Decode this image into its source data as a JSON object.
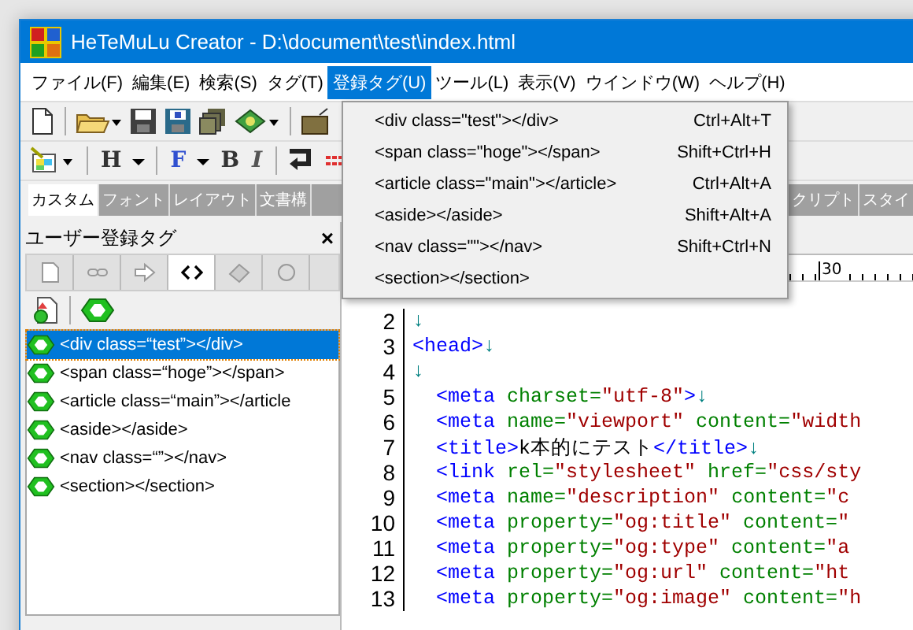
{
  "window": {
    "title": "HeTeMuLu Creator - D:\\document\\test\\index.html"
  },
  "menu": [
    {
      "label": "ファイル(F)",
      "selected": false
    },
    {
      "label": "編集(E)",
      "selected": false
    },
    {
      "label": "検索(S)",
      "selected": false
    },
    {
      "label": "タグ(T)",
      "selected": false
    },
    {
      "label": "登録タグ(U)",
      "selected": true
    },
    {
      "label": "ツール(L)",
      "selected": false
    },
    {
      "label": "表示(V)",
      "selected": false
    },
    {
      "label": "ウインドウ(W)",
      "selected": false
    },
    {
      "label": "ヘルプ(H)",
      "selected": false
    }
  ],
  "format_toolbar": {
    "buttons": [
      {
        "label": "H",
        "kind": "heading"
      },
      {
        "label": "F",
        "kind": "font"
      },
      {
        "label": "B",
        "kind": "bold"
      },
      {
        "label": "I",
        "kind": "italic"
      }
    ]
  },
  "category_tabs": [
    {
      "label": "カスタム",
      "selected": true
    },
    {
      "label": "フォント",
      "selected": false
    },
    {
      "label": "レイアウト",
      "selected": false
    },
    {
      "label": "文書構",
      "selected": false
    },
    {
      "label": "クリプト",
      "selected": false
    },
    {
      "label": "スタイ",
      "selected": false
    }
  ],
  "panel": {
    "title": "ユーザー登録タグ",
    "close": "×",
    "icon_tabs": [
      {
        "kind": "page",
        "selected": false
      },
      {
        "kind": "link",
        "selected": false
      },
      {
        "kind": "arrow",
        "selected": false
      },
      {
        "kind": "code",
        "selected": true
      },
      {
        "kind": "eraser",
        "selected": false
      },
      {
        "kind": "circle",
        "selected": false
      }
    ],
    "items": [
      {
        "label": "<div class=“test”></div>",
        "selected": true
      },
      {
        "label": "<span class=“hoge”></span>",
        "selected": false
      },
      {
        "label": "<article class=“main”></article",
        "selected": false
      },
      {
        "label": "<aside></aside>",
        "selected": false
      },
      {
        "label": "<nav class=“”></nav>",
        "selected": false
      },
      {
        "label": "<section></section>",
        "selected": false
      }
    ]
  },
  "dropdown": [
    {
      "label": "<div class=\"test\"></div>",
      "shortcut": "Ctrl+Alt+T"
    },
    {
      "label": "<span class=\"hoge\"></span>",
      "shortcut": "Shift+Ctrl+H"
    },
    {
      "label": "<article class=\"main\"></article>",
      "shortcut": "Ctrl+Alt+A"
    },
    {
      "label": "<aside></aside>",
      "shortcut": "Shift+Alt+A"
    },
    {
      "label": "<nav class=\"\"></nav>",
      "shortcut": "Shift+Ctrl+N"
    },
    {
      "label": "<section></section>"
    }
  ],
  "editor": {
    "ruler": "30",
    "lines": [
      {
        "number": "2",
        "segments": [
          {
            "kind": "newline",
            "text": "↓"
          }
        ]
      },
      {
        "number": "3",
        "segments": [
          {
            "kind": "tag",
            "text": "<head>"
          },
          {
            "kind": "newline",
            "text": "↓"
          }
        ]
      },
      {
        "number": "4",
        "segments": [
          {
            "kind": "newline",
            "text": "↓"
          }
        ]
      },
      {
        "number": "5",
        "segments": [
          {
            "kind": "tag",
            "text": "  <meta"
          },
          {
            "kind": "attr",
            "text": " charset="
          },
          {
            "kind": "value",
            "text": "\"utf-8\""
          },
          {
            "kind": "tag",
            "text": ">"
          },
          {
            "kind": "newline",
            "text": "↓"
          }
        ]
      },
      {
        "number": "6",
        "segments": [
          {
            "kind": "tag",
            "text": "  <meta"
          },
          {
            "kind": "attr",
            "text": " name="
          },
          {
            "kind": "value",
            "text": "\"viewport\""
          },
          {
            "kind": "attr",
            "text": " content="
          },
          {
            "kind": "value",
            "text": "\"width"
          }
        ]
      },
      {
        "number": "7",
        "segments": [
          {
            "kind": "tag",
            "text": "  <title>"
          },
          {
            "kind": "text",
            "text": "k本的にテスト"
          },
          {
            "kind": "tag",
            "text": "</title>"
          },
          {
            "kind": "newline",
            "text": "↓"
          }
        ]
      },
      {
        "number": "8",
        "segments": [
          {
            "kind": "tag",
            "text": "  <link"
          },
          {
            "kind": "attr",
            "text": " rel="
          },
          {
            "kind": "value",
            "text": "\"stylesheet\""
          },
          {
            "kind": "attr",
            "text": " href="
          },
          {
            "kind": "value",
            "text": "\"css/sty"
          }
        ]
      },
      {
        "number": "9",
        "segments": [
          {
            "kind": "tag",
            "text": "  <meta"
          },
          {
            "kind": "attr",
            "text": " name="
          },
          {
            "kind": "value",
            "text": "\"description\""
          },
          {
            "kind": "attr",
            "text": " content="
          },
          {
            "kind": "value",
            "text": "\"c"
          }
        ]
      },
      {
        "number": "10",
        "segments": [
          {
            "kind": "tag",
            "text": "  <meta"
          },
          {
            "kind": "attr",
            "text": " property="
          },
          {
            "kind": "value",
            "text": "\"og:title\""
          },
          {
            "kind": "attr",
            "text": " content="
          },
          {
            "kind": "value",
            "text": "\""
          }
        ]
      },
      {
        "number": "11",
        "segments": [
          {
            "kind": "tag",
            "text": "  <meta"
          },
          {
            "kind": "attr",
            "text": " property="
          },
          {
            "kind": "value",
            "text": "\"og:type\""
          },
          {
            "kind": "attr",
            "text": " content="
          },
          {
            "kind": "value",
            "text": "\"a"
          }
        ]
      },
      {
        "number": "12",
        "segments": [
          {
            "kind": "tag",
            "text": "  <meta"
          },
          {
            "kind": "attr",
            "text": " property="
          },
          {
            "kind": "value",
            "text": "\"og:url\""
          },
          {
            "kind": "attr",
            "text": " content="
          },
          {
            "kind": "value",
            "text": "\"ht"
          }
        ]
      },
      {
        "number": "13",
        "segments": [
          {
            "kind": "tag",
            "text": "  <meta"
          },
          {
            "kind": "attr",
            "text": " property="
          },
          {
            "kind": "value",
            "text": "\"og:image\""
          },
          {
            "kind": "attr",
            "text": " content="
          },
          {
            "kind": "value",
            "text": "\"h"
          }
        ]
      }
    ]
  }
}
